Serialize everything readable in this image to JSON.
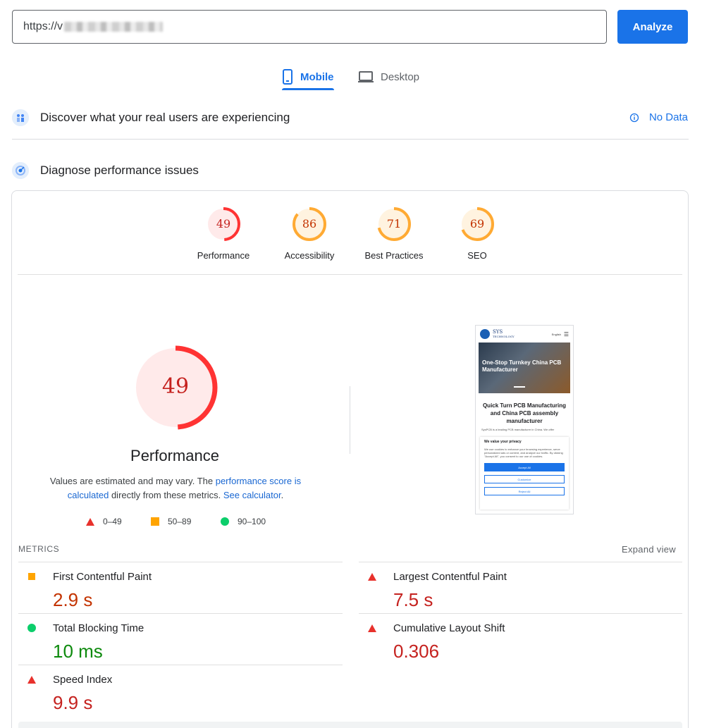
{
  "url_bar": {
    "prefix": "https://v",
    "analyze_label": "Analyze"
  },
  "tabs": [
    {
      "label": "Mobile"
    },
    {
      "label": "Desktop"
    }
  ],
  "field_data": {
    "title": "Discover what your real users are experiencing",
    "status": "No Data"
  },
  "lab_data": {
    "title": "Diagnose performance issues"
  },
  "categories": [
    {
      "label": "Performance",
      "score": "49",
      "fraction": 0.49,
      "color": "#ff3333",
      "bg": "#ffeaea"
    },
    {
      "label": "Accessibility",
      "score": "86",
      "fraction": 0.86,
      "color": "#ffaa33",
      "bg": "#fff3e0"
    },
    {
      "label": "Best Practices",
      "score": "71",
      "fraction": 0.71,
      "color": "#ffaa33",
      "bg": "#fff3e0"
    },
    {
      "label": "SEO",
      "score": "69",
      "fraction": 0.69,
      "color": "#ffaa33",
      "bg": "#fff3e0"
    }
  ],
  "performance": {
    "score": "49",
    "fraction": 0.49,
    "title": "Performance",
    "desc_1": "Values are estimated and may vary. The ",
    "link_score": "performance score is calculated",
    "desc_2": " directly from these metrics. ",
    "link_calc": "See calculator",
    "desc_3": "."
  },
  "legend": [
    {
      "range": "0–49",
      "shape": "triangle",
      "color": "#e8312c"
    },
    {
      "range": "50–89",
      "shape": "square",
      "color": "#ffa400"
    },
    {
      "range": "90–100",
      "shape": "circle",
      "color": "#0cce6b"
    }
  ],
  "preview": {
    "brand_line1": "SYS",
    "brand_line2": "TECHNOLOGY",
    "lang": "English",
    "hero_text": "One-Stop Turnkey China PCB Manufacturer",
    "heading": "Quick Turn PCB Manufacturing and China PCB assembly manufacturer",
    "body": "SysPCB is a leading PCB manufacturer in China. We offer",
    "cookie_title": "We value your privacy",
    "cookie_body": "We use cookies to enhance your browsing experience, serve personalized ads or content, and analyze our traffic. By clicking \"Accept All\", you consent to our use of cookies.",
    "accept": "Accept All",
    "customize": "Customize",
    "reject": "Reject All"
  },
  "metrics": {
    "label": "METRICS",
    "expand": "Expand view",
    "items": [
      {
        "name": "First Contentful Paint",
        "value": "2.9 s",
        "rating": "average"
      },
      {
        "name": "Largest Contentful Paint",
        "value": "7.5 s",
        "rating": "poor"
      },
      {
        "name": "Total Blocking Time",
        "value": "10 ms",
        "rating": "good"
      },
      {
        "name": "Cumulative Layout Shift",
        "value": "0.306",
        "rating": "poor"
      },
      {
        "name": "Speed Index",
        "value": "9.9 s",
        "rating": "poor"
      }
    ]
  }
}
